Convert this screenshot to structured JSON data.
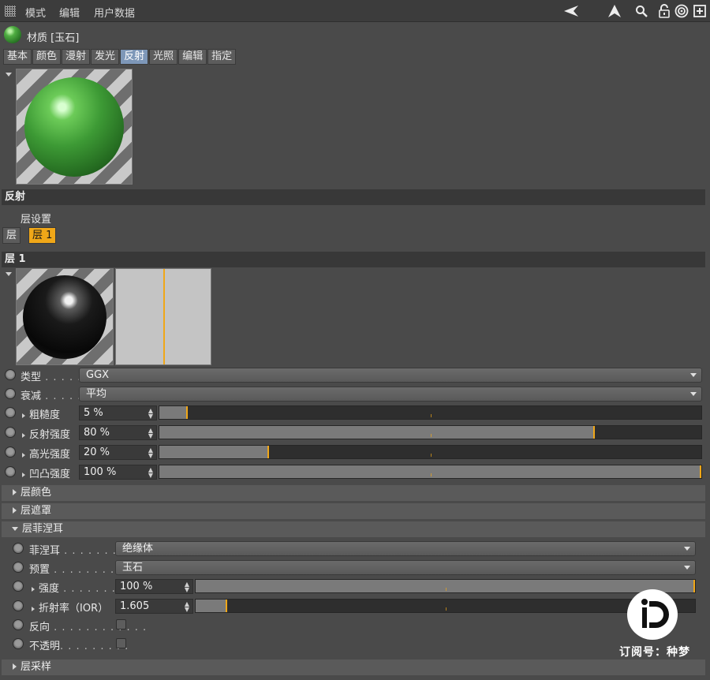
{
  "menu": {
    "items": [
      "模式",
      "编辑",
      "用户数据"
    ]
  },
  "toolbar": {
    "icons": [
      "arrow-left-icon",
      "arrow-up-icon",
      "search-icon",
      "lock-icon",
      "target-icon",
      "new-panel-icon"
    ]
  },
  "material": {
    "title": "材质 [玉石]"
  },
  "tabs": [
    "基本",
    "颜色",
    "漫射",
    "发光",
    "反射",
    "光照",
    "编辑",
    "指定"
  ],
  "active_tab": "反射",
  "reflection": {
    "section_title": "反射",
    "layer_settings": "层设置",
    "layer_buttons": [
      "层",
      "层 1"
    ],
    "active_layer": "层 1",
    "layer_title": "层 1"
  },
  "props": {
    "type": {
      "label": "类型",
      "dots": " . . . . .",
      "value": "GGX"
    },
    "attenuation": {
      "label": "衰减",
      "dots": " . . . . .",
      "value": "平均"
    },
    "roughness": {
      "label": "粗糙度",
      "value": "5 %",
      "level": 0.05
    },
    "reflection_strength": {
      "label": "反射强度",
      "value": "80 %",
      "level": 0.8
    },
    "specular_strength": {
      "label": "高光强度",
      "value": "20 %",
      "level": 0.2
    },
    "bump_strength": {
      "label": "凹凸强度",
      "value": "100 %",
      "level": 1.0
    }
  },
  "subsections": {
    "layer_color": "层颜色",
    "layer_mask": "层遮罩",
    "layer_fresnel": "层菲涅耳",
    "layer_sampling": "层采样"
  },
  "fresnel": {
    "fresnel": {
      "label": "菲涅耳",
      "dots": " . . . . . . . . .",
      "value": "绝缘体"
    },
    "preset": {
      "label": "预置",
      "dots": " . . . . . . . . . . . .",
      "value": "玉石"
    },
    "strength": {
      "label": "强度",
      "dots": " . . . . . . . .",
      "value": "100 %",
      "level": 1.0
    },
    "ior": {
      "label": "折射率（IOR）",
      "value": "1.605",
      "level": 0.06
    },
    "invert": {
      "label": "反向",
      "dots": " . . . . . . . . . . . .",
      "checked": false
    },
    "opaque": {
      "label": "不透明",
      "dots": ". . . . . . . . .",
      "checked": false
    }
  },
  "watermark": {
    "text": "订阅号：种梦",
    "logo_letters": "iD"
  },
  "colors": {
    "accent": "#f0a718",
    "active_tab": "#7d97b8",
    "background": "#4a4a4a"
  }
}
